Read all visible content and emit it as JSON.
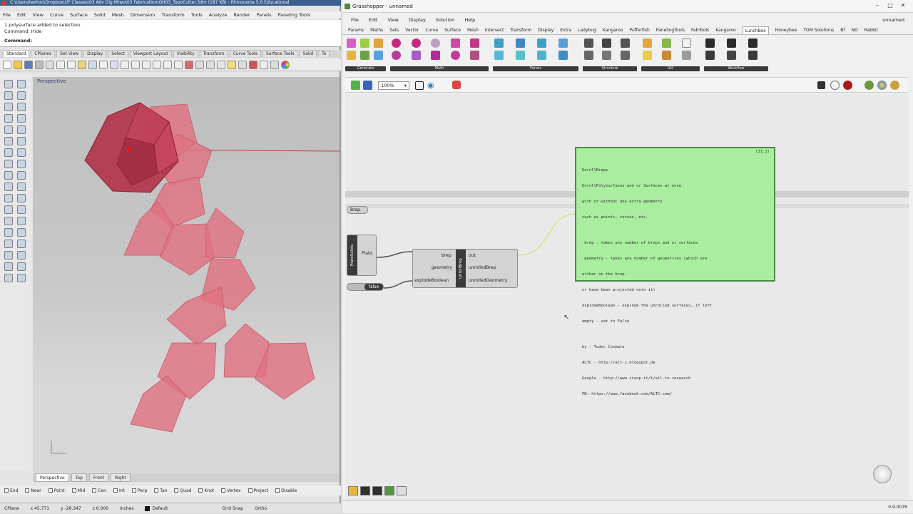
{
  "rhino": {
    "title": "C:\\Users\\leehoo\\Dropbox\\UF Classes\\03 Adv Dig Mtwo\\03 Fabrication\\GH03_TopoCutter.3dm (187 KB) - Rhinoceros 5.0 Educational",
    "menu": [
      "File",
      "Edit",
      "View",
      "Curve",
      "Surface",
      "Solid",
      "Mesh",
      "Dimension",
      "Transform",
      "Tools",
      "Analyze",
      "Render",
      "Panels",
      "Paneling Tools"
    ],
    "command_history": [
      "1 polysurface added to selection.",
      "Command: Hide"
    ],
    "command_prompt": "Command:",
    "toolbar_tabs": [
      "Standard",
      "CPlanes",
      "Set View",
      "Display",
      "Select",
      "Viewport Layout",
      "Visibility",
      "Transform",
      "Curve Tools",
      "Surface Tools",
      "Solid",
      "To"
    ],
    "viewport_label": "Perspective",
    "viewport_tabs": [
      "Perspective",
      "Top",
      "Front",
      "Right"
    ],
    "osnaps": [
      "End",
      "Near",
      "Point",
      "Mid",
      "Cen",
      "Int",
      "Perp",
      "Tan",
      "Quad",
      "Knot",
      "Vertex",
      "Project",
      "Disable"
    ],
    "status": {
      "cplane": "CPlane",
      "x": "x 45.771",
      "y": "y -28.347",
      "z": "z 0.000",
      "units": "Inches",
      "layer": "Default",
      "grid_snap": "Grid Snap",
      "ortho": "Ortho"
    },
    "colors": {
      "solid": "#b3324a",
      "unroll": "#e07080"
    }
  },
  "gh": {
    "title": "Grasshopper - unnamed",
    "menu": [
      "File",
      "Edit",
      "View",
      "Display",
      "Solution",
      "Help"
    ],
    "file_name": "unnamed",
    "tabs": [
      "Params",
      "Maths",
      "Sets",
      "Vector",
      "Curve",
      "Surface",
      "Mesh",
      "Intersect",
      "Transform",
      "Display",
      "Extra",
      "Ladybug",
      "Kangaroo",
      "Pufferfish",
      "PanelingTools",
      "FabTools",
      "Kangaroo",
      "LunchBox",
      "Honeybee",
      "TOM Solutions",
      "Bf",
      "ND",
      "Rabbit"
    ],
    "active_tab": "LunchBox",
    "ribbon_groups": [
      "Generate",
      "Math",
      "Panels",
      "Structure",
      "Util",
      "Workflow"
    ],
    "zoom": "100%",
    "components": {
      "brep_param": "Brep",
      "plato": "Plato",
      "plato_vert": "PlatoSolids",
      "toggle": "false",
      "unroll_inputs": [
        "brep",
        "geometry",
        "explodeBoolean"
      ],
      "unroll_outputs": [
        "out",
        "unrolledBrep",
        "unrolledGeometry"
      ],
      "unroll_name": "UnrollBrep"
    },
    "panel": {
      "header": "(31:1)",
      "lines": [
        "UnrollBreps",
        "UnrollPolysurfaces and or Surfaces at once",
        "with or without any extra geometry",
        "such as points, curves, etc.",
        "",
        " brep - takes any number of breps and or surfaces",
        " geometry - takes any number of geometries (which are",
        "either on the brep,",
        "or have been projected onto it)",
        "explodeBoolean - explode the unrolled surfaces, if left",
        "empty - set to False",
        "",
        "by - Tudor Cosmatu",
        "ALTC - http://alt-c.blogspot.de",
        "Google - http://www.scoop.it/t/all-to-research",
        "FB: https://www.facebook.com/ALTC-com/"
      ]
    },
    "status_right": "0.9.0076",
    "colors": {
      "panel": "#a9ee9f",
      "wire": "#d4e36a"
    }
  }
}
